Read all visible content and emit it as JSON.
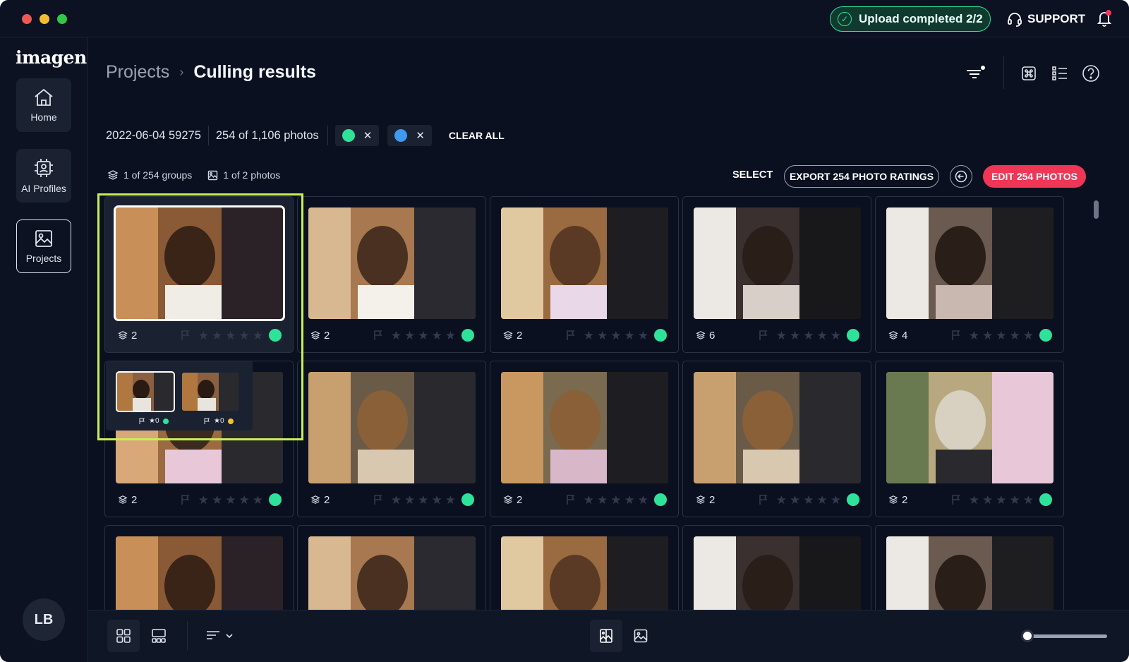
{
  "topbar": {
    "upload_status": "Upload completed 2/2",
    "support_label": "SUPPORT"
  },
  "sidebar": {
    "logo": "imagen",
    "items": [
      {
        "label": "Home",
        "icon": "home-icon"
      },
      {
        "label": "AI Profiles",
        "icon": "ai-chip-icon"
      },
      {
        "label": "Projects",
        "icon": "image-icon",
        "active": true
      }
    ],
    "avatar_initials": "LB"
  },
  "breadcrumb": {
    "parent": "Projects",
    "separator": "›",
    "current": "Culling results"
  },
  "filters": {
    "project_id": "2022-06-04 59275",
    "photo_count": "254 of 1,106 photos",
    "chips": [
      {
        "color": "#2fe29a",
        "remove": "✕"
      },
      {
        "color": "#3d9bf0",
        "remove": "✕"
      }
    ],
    "clear_all": "CLEAR ALL"
  },
  "toolbar": {
    "groups": "1 of 254 groups",
    "photos": "1 of 2 photos",
    "select": "SELECT",
    "export": "EXPORT 254 PHOTO RATINGS",
    "edit": "EDIT 254 PHOTOS"
  },
  "cards": [
    {
      "count": "2",
      "label_color": "#2fe29a",
      "stars": 0
    },
    {
      "count": "2",
      "label_color": "#2fe29a",
      "stars": 0
    },
    {
      "count": "2",
      "label_color": "#2fe29a",
      "stars": 0
    },
    {
      "count": "6",
      "label_color": "#2fe29a",
      "stars": 0
    },
    {
      "count": "4",
      "label_color": "#2fe29a",
      "stars": 0
    },
    {
      "count": "2",
      "label_color": "#2fe29a",
      "stars": 0
    },
    {
      "count": "2",
      "label_color": "#2fe29a",
      "stars": 0
    },
    {
      "count": "2",
      "label_color": "#2fe29a",
      "stars": 0
    },
    {
      "count": "2",
      "label_color": "#2fe29a",
      "stars": 0
    },
    {
      "count": "2",
      "label_color": "#2fe29a",
      "stars": 0
    }
  ],
  "popover": {
    "photos": [
      {
        "star_text": "★0",
        "label_color": "#2fe29a"
      },
      {
        "star_text": "★0",
        "label_color": "#f2c230"
      }
    ]
  },
  "colors": {
    "accent_green": "#2fe29a",
    "accent_red": "#ef3657",
    "highlight": "#c8f055"
  }
}
